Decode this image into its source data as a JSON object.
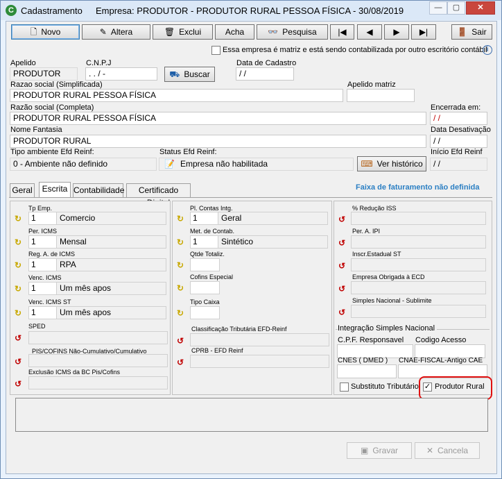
{
  "window": {
    "title": "Cadastramento",
    "subtitle": "Empresa: PRODUTOR - PRODUTOR RURAL PESSOA FÍSICA - 30/08/2019",
    "min": "—",
    "max": "▢",
    "close": "✕"
  },
  "toolbar": {
    "novo": "Novo",
    "altera": "Altera",
    "exclui": "Exclui",
    "acha": "Acha",
    "pesquisa": "Pesquisa",
    "first": "|◀",
    "prev": "◀",
    "next": "▶",
    "last": "▶|",
    "sair": "Sair"
  },
  "matriz_check": {
    "label": "Essa empresa é matriz e está sendo contabilizada por outro escritório contábil",
    "checked": false,
    "info": "i"
  },
  "form": {
    "apelido_label": "Apelido",
    "apelido": "PRODUTOR",
    "cnpj_label": "C.N.P.J",
    "cnpj": " .  .  /  -",
    "buscar": "Buscar",
    "data_cadastro_label": "Data de Cadastro",
    "data_cadastro": " / /",
    "razao_simpl_label": "Razao social (Simplificada)",
    "razao_simpl": "PRODUTOR RURAL PESSOA FÍSICA",
    "apelido_matriz_label": "Apelido matriz",
    "apelido_matriz": "",
    "razao_completa_label": "Razão social (Completa)",
    "razao_completa": "PRODUTOR RURAL PESSOA FÍSICA",
    "encerrada_label": "Encerrada em:",
    "encerrada": " / /",
    "nome_fantasia_label": "Nome Fantasia",
    "nome_fantasia": "PRODUTOR RURAL",
    "data_desativacao_label": "Data Desativação",
    "data_desativacao": " / /",
    "tipo_ambiente_label": "Tipo ambiente Efd Reinf:",
    "tipo_ambiente": "0 - Ambiente não definido",
    "status_efd_label": "Status Efd Reinf:",
    "status_efd": "Empresa não habilitada",
    "ver_historico": "Ver histórico",
    "inicio_efd_label": "Início Efd Reinf",
    "inicio_efd": " / /"
  },
  "tabs": [
    "Geral",
    "Escrita",
    "Contabilidade",
    "Certificado Digital"
  ],
  "faixa": "Faixa de faturamento não definida",
  "col1": {
    "tp_emp_label": "Tp Emp.",
    "tp_emp_code": "1",
    "tp_emp_desc": "Comercio",
    "per_icms_label": "Per. ICMS",
    "per_icms_code": "1",
    "per_icms_desc": "Mensal",
    "reg_icms_label": "Reg. A. de ICMS",
    "reg_icms_code": "1",
    "reg_icms_desc": "RPA",
    "venc_icms_label": "Venc. ICMS",
    "venc_icms_code": "1",
    "venc_icms_desc": "Um mês apos",
    "venc_icms_st_label": "Venc. ICMS ST",
    "venc_icms_st_code": "1",
    "venc_icms_st_desc": "Um mês apos",
    "sped_label": "SPED",
    "pis_label": "PIS/COFINS Não-Cumulativo/Cumulativo",
    "exclusao_label": "Exclusão ICMS da BC Pis/Cofins"
  },
  "col2": {
    "pl_contas_label": "Pl. Contas Intg.",
    "pl_contas_code": "1",
    "pl_contas_desc": "Geral",
    "met_contab_label": "Met. de Contab.",
    "met_contab_code": "1",
    "met_contab_desc": "Sintético",
    "qtde_label": "Qtde Totaliz.",
    "cofins_label": "Cofins Especial",
    "tipo_caixa_label": "Tipo Caixa",
    "class_trib_label": "Classificação Tributária EFD-Reinf",
    "cprb_label": "CPRB - EFD Reinf"
  },
  "col3": {
    "reducao_iss_label": "% Redução ISS",
    "per_ipi_label": "Per. A.  IPI",
    "inscr_st_label": "Inscr.Estadual ST",
    "obrigada_ecd_label": "Empresa Obrigada à ECD",
    "simples_sublimite_label": "Simples Nacional - Sublimite",
    "integracao_label": "Integração Simples Nacional",
    "cpf_resp_label": "C.P.F. Responsavel",
    "codigo_acesso_label": "Codigo Acesso",
    "cnes_label": "CNES ( DMED )",
    "cnae_label": "CNAE-FISCAL-Antigo CAE",
    "substituto_label": "Substituto Tributário",
    "substituto_checked": false,
    "produtor_label": "Produtor Rural",
    "produtor_checked": true
  },
  "footer": {
    "gravar": "Gravar",
    "cancela": "Cancela"
  },
  "colors": {
    "accent_blue": "#2b7fc3",
    "highlight_red": "#e01010",
    "red_date": "#c00000"
  }
}
